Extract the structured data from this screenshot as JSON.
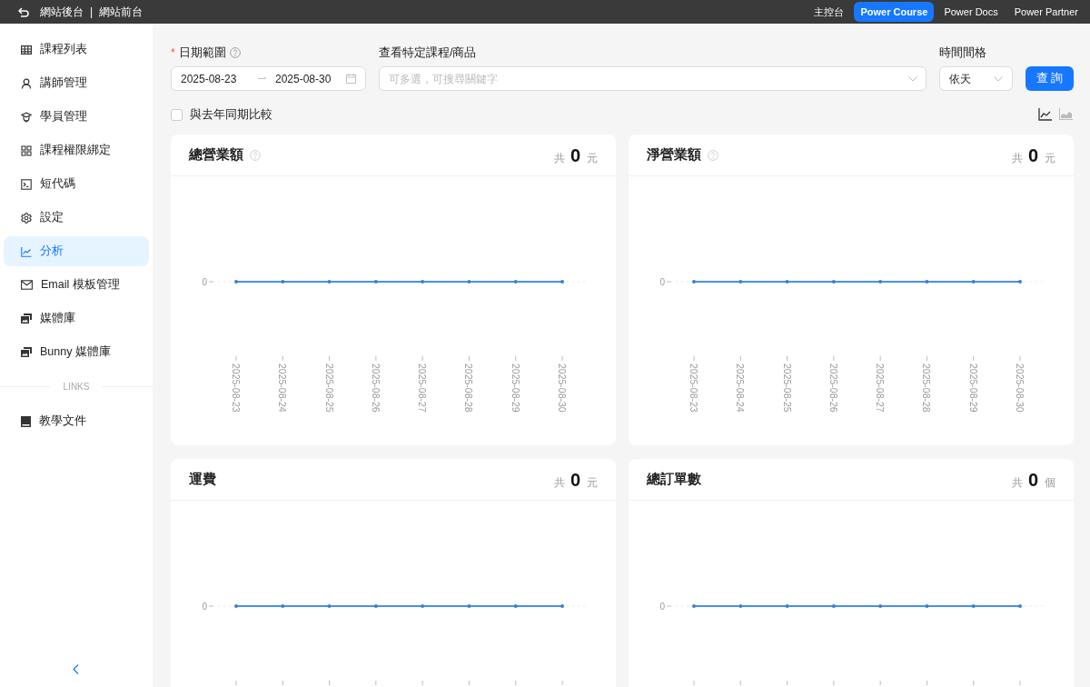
{
  "top_bar": {
    "links": [
      {
        "label": "網站後台"
      },
      {
        "label": "網站前台"
      }
    ],
    "separator": "|",
    "nav": [
      {
        "label": "主控台",
        "selected": false
      },
      {
        "label": "Power Course",
        "selected": true
      },
      {
        "label": "Power Docs",
        "selected": false
      },
      {
        "label": "Power Partner",
        "selected": false
      }
    ]
  },
  "sidebar": {
    "items": [
      {
        "label": "課程列表",
        "selected": false
      },
      {
        "label": "講師管理",
        "selected": false
      },
      {
        "label": "學員管理",
        "selected": false
      },
      {
        "label": "課程權限綁定",
        "selected": false
      },
      {
        "label": "短代碼",
        "selected": false
      },
      {
        "label": "設定",
        "selected": false
      },
      {
        "label": "分析",
        "selected": true
      },
      {
        "label": "Email 模板管理",
        "selected": false
      },
      {
        "label": "媒體庫",
        "selected": false
      },
      {
        "label": "Bunny 媒體庫",
        "selected": false
      }
    ],
    "section_label": "LINKS",
    "link_items": [
      {
        "label": "教學文件",
        "selected": false
      }
    ]
  },
  "filters": {
    "date_range": {
      "label": "日期範圍",
      "required_mark": "*",
      "start": "2025-08-23",
      "end": "2025-08-30"
    },
    "product": {
      "label": "查看特定課程/商品",
      "placeholder": "可多選，可搜尋關鍵字"
    },
    "interval": {
      "label": "時間間格",
      "value": "依天"
    },
    "query_button": "查 詢",
    "compare": {
      "label": "與去年同期比較",
      "checked": false
    },
    "chart_types": [
      {
        "kind": "line",
        "selected": true
      },
      {
        "kind": "area",
        "selected": false
      }
    ]
  },
  "cards": [
    {
      "title": "總營業額",
      "help": true,
      "prefix": "共",
      "total": "0",
      "unit": "元",
      "y_label": "0",
      "x_labels": [
        "2025-08-23",
        "2025-08-24",
        "2025-08-25",
        "2025-08-26",
        "2025-08-27",
        "2025-08-28",
        "2025-08-29",
        "2025-08-30"
      ]
    },
    {
      "title": "淨營業額",
      "help": true,
      "prefix": "共",
      "total": "0",
      "unit": "元",
      "y_label": "0",
      "x_labels": [
        "2025-08-23",
        "2025-08-24",
        "2025-08-25",
        "2025-08-26",
        "2025-08-27",
        "2025-08-28",
        "2025-08-29",
        "2025-08-30"
      ]
    },
    {
      "title": "運費",
      "help": false,
      "prefix": "共",
      "total": "0",
      "unit": "元",
      "y_label": "0"
    },
    {
      "title": "總訂單數",
      "help": false,
      "prefix": "共",
      "total": "0",
      "unit": "個",
      "y_label": "0"
    }
  ]
}
